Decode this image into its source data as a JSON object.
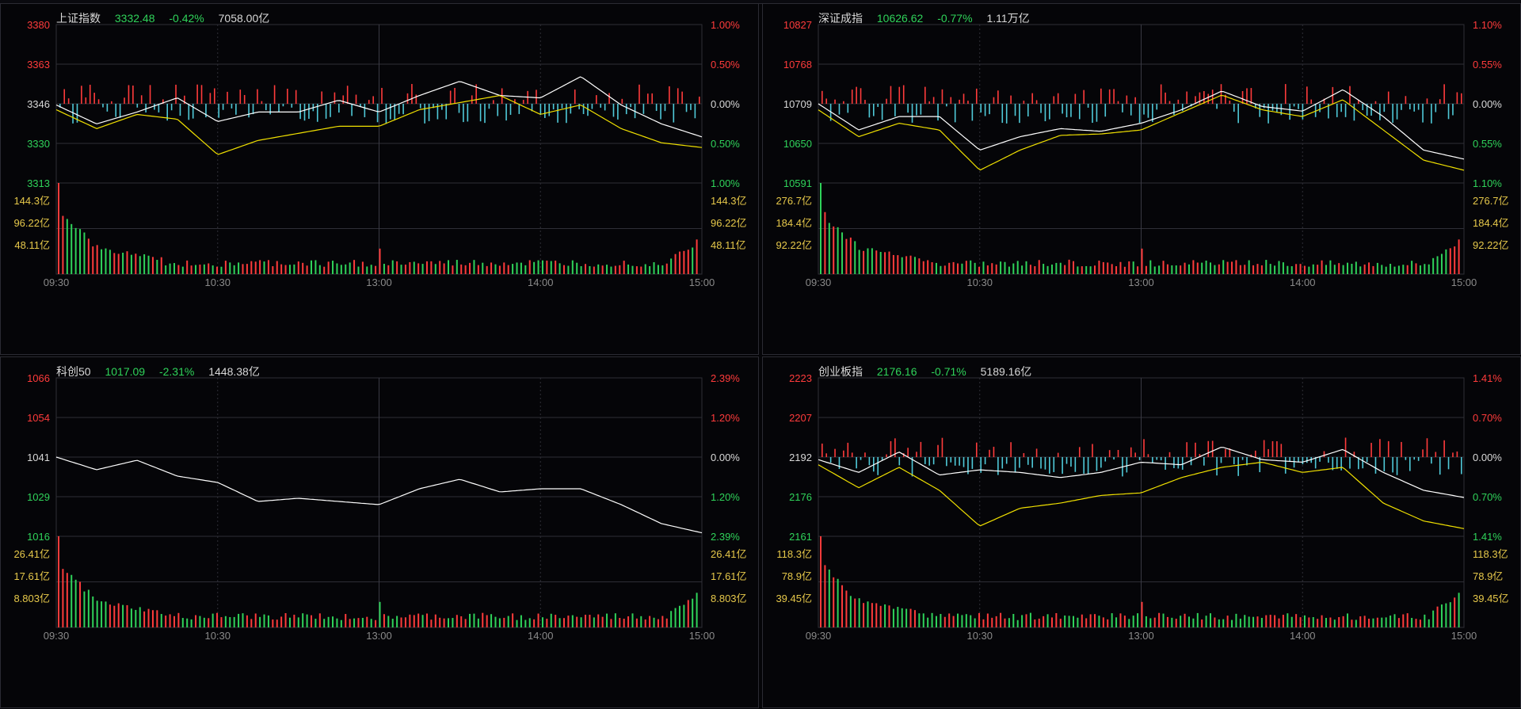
{
  "colors": {
    "up": "#ff3b3b",
    "down": "#2fd35a",
    "flat": "#d8d8d8",
    "volume_label": "#e6c84a",
    "price_line": "#ffffff",
    "avg_line": "#f0e000",
    "bar_up": "#ff3b3b",
    "bar_down": "#4fc9d8",
    "grid": "#2e2e36",
    "time_label": "#8a8a8a"
  },
  "panels": [
    {
      "id": "sh",
      "name": "上证指数",
      "price": "3332.48",
      "change": "-0.42%",
      "amount": "7058.00亿",
      "price_ticks": [
        "3380",
        "3363",
        "3346",
        "3330",
        "3313"
      ],
      "pct_ticks": [
        "1.00%",
        "0.50%",
        "0.00%",
        "0.50%",
        "1.00%"
      ],
      "vol_ticks": [
        "144.3亿",
        "96.22亿",
        "48.11亿"
      ],
      "time_ticks": [
        "09:30",
        "10:30",
        "13:00",
        "14:00",
        "15:00"
      ]
    },
    {
      "id": "sz",
      "name": "深证成指",
      "price": "10626.62",
      "change": "-0.77%",
      "amount": "1.11万亿",
      "price_ticks": [
        "10827",
        "10768",
        "10709",
        "10650",
        "10591"
      ],
      "pct_ticks": [
        "1.10%",
        "0.55%",
        "0.00%",
        "0.55%",
        "1.10%"
      ],
      "vol_ticks": [
        "276.7亿",
        "184.4亿",
        "92.22亿"
      ],
      "time_ticks": [
        "09:30",
        "10:30",
        "13:00",
        "14:00",
        "15:00"
      ]
    },
    {
      "id": "kc",
      "name": "科创50",
      "price": "1017.09",
      "change": "-2.31%",
      "amount": "1448.38亿",
      "price_ticks": [
        "1066",
        "1054",
        "1041",
        "1029",
        "1016"
      ],
      "pct_ticks": [
        "2.39%",
        "1.20%",
        "0.00%",
        "1.20%",
        "2.39%"
      ],
      "vol_ticks": [
        "26.41亿",
        "17.61亿",
        "8.803亿"
      ],
      "time_ticks": [
        "09:30",
        "10:30",
        "13:00",
        "14:00",
        "15:00"
      ]
    },
    {
      "id": "cy",
      "name": "创业板指",
      "price": "2176.16",
      "change": "-0.71%",
      "amount": "5189.16亿",
      "price_ticks": [
        "2223",
        "2207",
        "2192",
        "2176",
        "2161"
      ],
      "pct_ticks": [
        "1.41%",
        "0.70%",
        "0.00%",
        "0.70%",
        "1.41%"
      ],
      "vol_ticks": [
        "118.3亿",
        "78.9亿",
        "39.45亿"
      ],
      "time_ticks": [
        "09:30",
        "10:30",
        "13:00",
        "14:00",
        "15:00"
      ]
    }
  ],
  "chart_data": [
    {
      "type": "line",
      "title": "上证指数",
      "x": [
        "09:30",
        "09:45",
        "10:00",
        "10:15",
        "10:30",
        "10:45",
        "11:00",
        "11:15",
        "11:30/13:00",
        "13:15",
        "13:30",
        "13:45",
        "14:00",
        "14:15",
        "14:30",
        "14:45",
        "15:00"
      ],
      "series": [
        {
          "values": [
            3346,
            3338,
            3343,
            3349,
            3339,
            3343,
            3343,
            3348,
            3343,
            3350,
            3356,
            3350,
            3349,
            3358,
            3346,
            3338,
            3332.5
          ]
        },
        {
          "values": [
            3344,
            3336,
            3342,
            3340,
            3325,
            3331,
            3334,
            3337,
            3337,
            3344,
            3347,
            3350,
            3342,
            3346,
            3336,
            3330,
            3328
          ]
        }
      ],
      "ylim": [
        3313,
        3380
      ],
      "y2lim": [
        -1.0,
        1.0
      ],
      "volume_ylim": [
        0,
        144.3
      ],
      "volume_label_unit": "亿"
    },
    {
      "type": "line",
      "title": "深证成指",
      "x": [
        "09:30",
        "09:45",
        "10:00",
        "10:15",
        "10:30",
        "10:45",
        "11:00",
        "11:15",
        "11:30/13:00",
        "13:15",
        "13:30",
        "13:45",
        "14:00",
        "14:15",
        "14:30",
        "14:45",
        "15:00"
      ],
      "series": [
        {
          "values": [
            10709,
            10670,
            10690,
            10690,
            10640,
            10660,
            10672,
            10668,
            10680,
            10700,
            10728,
            10705,
            10698,
            10730,
            10690,
            10640,
            10626.6
          ]
        },
        {
          "values": [
            10700,
            10660,
            10680,
            10670,
            10610,
            10640,
            10662,
            10664,
            10670,
            10696,
            10722,
            10700,
            10690,
            10715,
            10670,
            10625,
            10610
          ]
        }
      ],
      "ylim": [
        10591,
        10827
      ],
      "y2lim": [
        -1.1,
        1.1
      ],
      "volume_ylim": [
        0,
        276.7
      ],
      "volume_label_unit": "亿"
    },
    {
      "type": "line",
      "title": "科创50",
      "x": [
        "09:30",
        "09:45",
        "10:00",
        "10:15",
        "10:30",
        "10:45",
        "11:00",
        "11:15",
        "11:30/13:00",
        "13:15",
        "13:30",
        "13:45",
        "14:00",
        "14:15",
        "14:30",
        "14:45",
        "15:00"
      ],
      "series": [
        {
          "values": [
            1041,
            1037,
            1040,
            1035,
            1033,
            1027,
            1028,
            1027,
            1026,
            1031,
            1034,
            1030,
            1031,
            1031,
            1026,
            1020,
            1017.1
          ]
        }
      ],
      "ylim": [
        1016,
        1066
      ],
      "y2lim": [
        -2.39,
        2.39
      ],
      "volume_ylim": [
        0,
        26.41
      ],
      "volume_label_unit": "亿"
    },
    {
      "type": "line",
      "title": "创业板指",
      "x": [
        "09:30",
        "09:45",
        "10:00",
        "10:15",
        "10:30",
        "10:45",
        "11:00",
        "11:15",
        "11:30/13:00",
        "13:15",
        "13:30",
        "13:45",
        "14:00",
        "14:15",
        "14:30",
        "14:45",
        "15:00"
      ],
      "series": [
        {
          "values": [
            2191,
            2186,
            2194,
            2185,
            2187,
            2186,
            2184,
            2186,
            2190,
            2189,
            2196,
            2191,
            2190,
            2195,
            2186,
            2179,
            2176.2
          ]
        },
        {
          "values": [
            2189,
            2180,
            2188,
            2179,
            2165,
            2172,
            2174,
            2177,
            2178,
            2184,
            2188,
            2190,
            2186,
            2188,
            2174,
            2167,
            2164
          ]
        }
      ],
      "ylim": [
        2161,
        2223
      ],
      "y2lim": [
        -1.41,
        1.41
      ],
      "volume_ylim": [
        0,
        118.3
      ],
      "volume_label_unit": "亿"
    }
  ]
}
